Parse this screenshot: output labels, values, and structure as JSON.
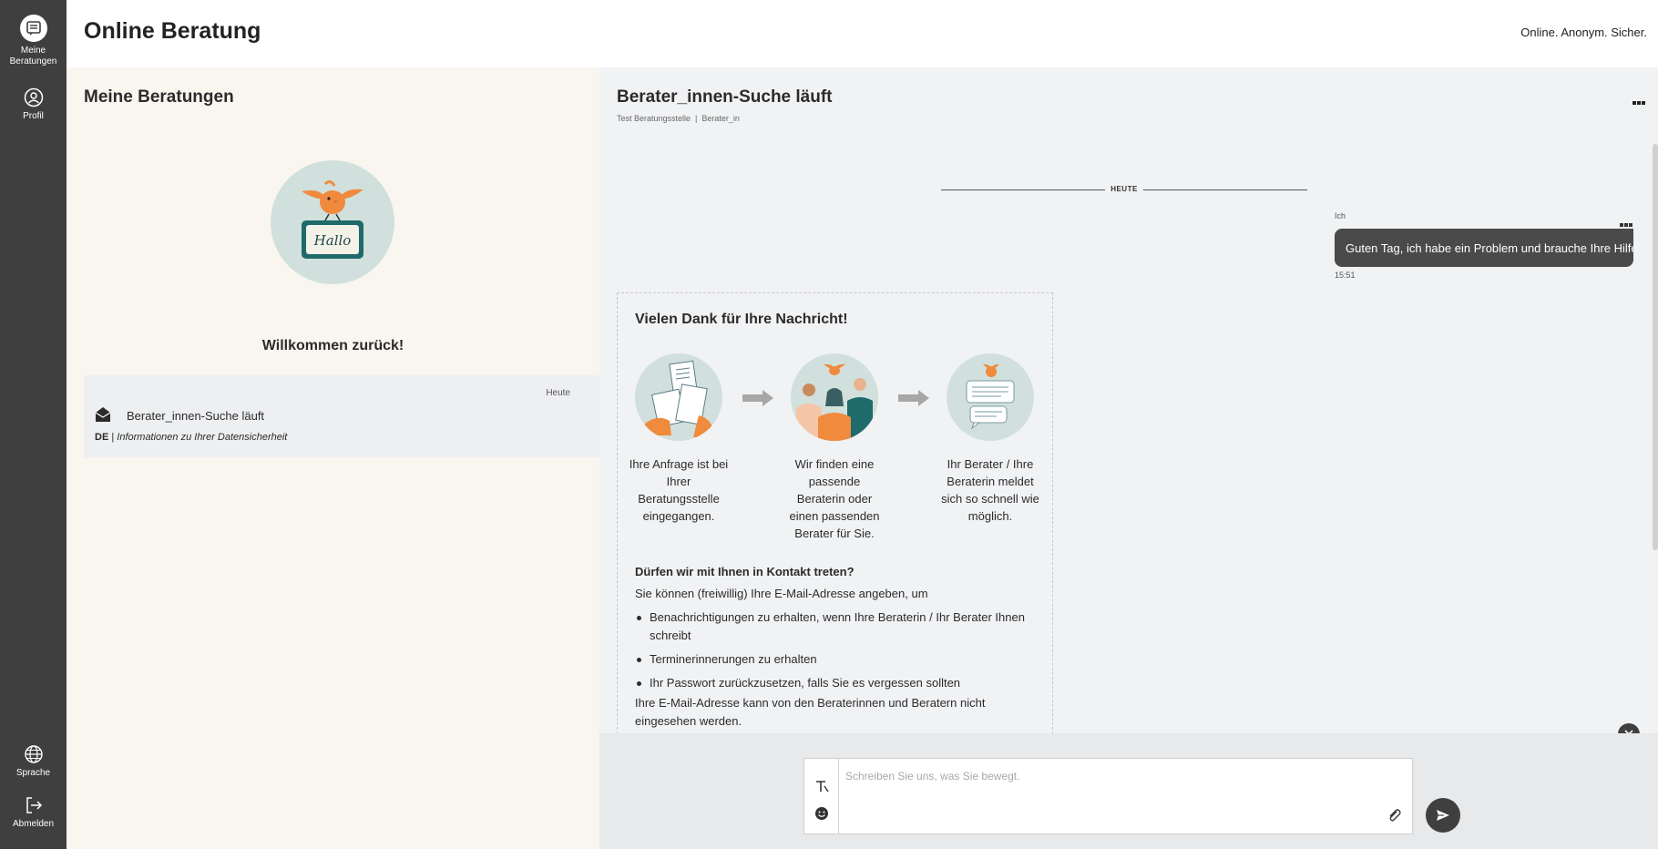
{
  "nav": {
    "items": [
      {
        "label": "Meine Beratungen",
        "icon": "chat-list-icon",
        "active": true
      },
      {
        "label": "Profil",
        "icon": "user-icon"
      },
      {
        "label": "Sprache",
        "icon": "globe-icon"
      },
      {
        "label": "Abmelden",
        "icon": "logout-icon"
      }
    ]
  },
  "header": {
    "title": "Online Beratung",
    "claim": "Online. Anonym. Sicher."
  },
  "sessions": {
    "title": "Meine Beratungen",
    "welcome": "Willkommen zurück!",
    "welcome_sign": "Hallo",
    "items": [
      {
        "date": "Heute",
        "subject": "Berater_innen-Suche läuft",
        "lang": "DE",
        "preview": "Informationen zu Ihrer Datensicherheit"
      }
    ]
  },
  "chat": {
    "title": "Berater_innen-Suche läuft",
    "agency": "Test Beratungsstelle",
    "role": "Berater_in",
    "day_divider": "HEUTE",
    "message": {
      "user": "Ich",
      "text": "Guten Tag, ich habe ein Problem und brauche Ihre Hilfe...",
      "time": "15:51"
    },
    "info": {
      "title": "Vielen Dank für Ihre Nachricht!",
      "steps": [
        "Ihre Anfrage ist bei Ihrer Beratungsstelle eingegangen.",
        "Wir finden eine passende Beraterin oder einen passenden Berater für Sie.",
        "Ihr Berater / Ihre Beraterin meldet sich so schnell wie möglich."
      ],
      "contact_head": "Dürfen wir mit Ihnen in Kontakt treten?",
      "contact_intro": "Sie können (freiwillig) Ihre E-Mail-Adresse angeben, um",
      "contact_points": [
        "Benachrichtigungen zu erhalten, wenn Ihre Beraterin / Ihr Berater Ihnen schreibt",
        "Terminerinnerungen zu erhalten",
        "Ihr Passwort zurückzusetzen, falls Sie es vergessen sollten"
      ],
      "contact_foot": "Ihre E-Mail-Adresse kann von den Beraterinnen und Beratern nicht eingesehen werden."
    },
    "composer": {
      "placeholder": "Schreiben Sie uns, was Sie bewegt."
    }
  },
  "colors": {
    "nav_bg": "#3f3f3f",
    "list_bg": "#f9f6f0",
    "chat_bg": "#f1f2f4",
    "bubble_bg": "#4a4a4a",
    "illustration_bg": "#d1e0dc",
    "accent_orange": "#f08a3c"
  }
}
